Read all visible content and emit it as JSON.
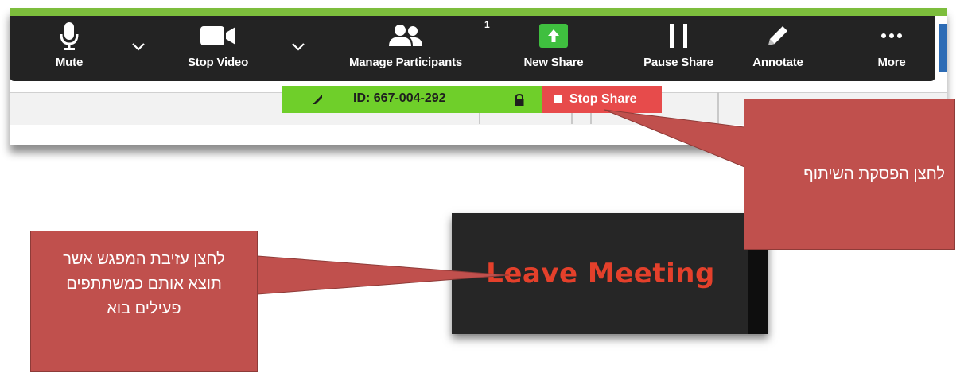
{
  "toolbar": {
    "items": [
      {
        "label": "Mute",
        "icon": "microphone-icon"
      },
      {
        "label": "Stop Video",
        "icon": "video-camera-icon"
      },
      {
        "label": "Manage Participants",
        "icon": "participants-icon",
        "badge": "1"
      },
      {
        "label": "New Share",
        "icon": "share-arrow-icon"
      },
      {
        "label": "Pause Share",
        "icon": "pause-icon"
      },
      {
        "label": "Annotate",
        "icon": "pencil-icon"
      },
      {
        "label": "More",
        "icon": "more-dots-icon"
      }
    ]
  },
  "share_bar": {
    "meeting_id": "ID: 667-004-292",
    "stop_share": "Stop Share"
  },
  "leave_meeting": {
    "label": "Leave Meeting"
  },
  "callouts": {
    "stop_share_note": "לחצן הפסקת השיתוף",
    "leave_note": "לחצן עזיבת המפגש אשר תוצא אותם כמשתתפים פעילים בוא"
  },
  "colors": {
    "toolbar_bg": "#232323",
    "share_green": "#6fcf2a",
    "stop_red": "#e74b4b",
    "leave_red": "#e4402b",
    "callout": "#c0504d"
  }
}
